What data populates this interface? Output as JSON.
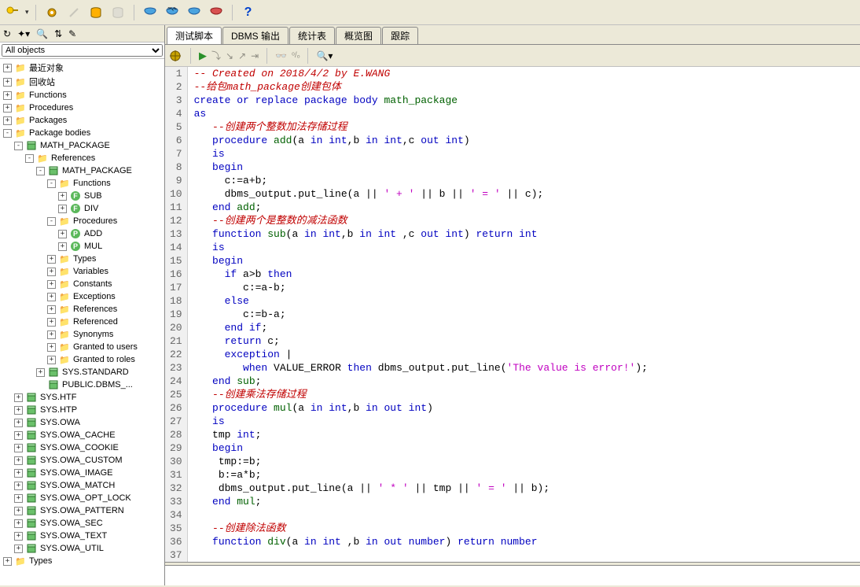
{
  "topToolbar": {
    "help": "?"
  },
  "leftPanel": {
    "filterLabel": "All objects",
    "tree": [
      {
        "indent": 0,
        "toggle": "+",
        "icon": "folder",
        "label": "最近对象"
      },
      {
        "indent": 0,
        "toggle": "+",
        "icon": "folder",
        "label": "回收站"
      },
      {
        "indent": 0,
        "toggle": "+",
        "icon": "folder",
        "label": "Functions"
      },
      {
        "indent": 0,
        "toggle": "+",
        "icon": "folder",
        "label": "Procedures"
      },
      {
        "indent": 0,
        "toggle": "+",
        "icon": "folder",
        "label": "Packages"
      },
      {
        "indent": 0,
        "toggle": "-",
        "icon": "folder",
        "label": "Package bodies"
      },
      {
        "indent": 1,
        "toggle": "-",
        "icon": "pkg",
        "label": "MATH_PACKAGE"
      },
      {
        "indent": 2,
        "toggle": "-",
        "icon": "folder",
        "label": "References"
      },
      {
        "indent": 3,
        "toggle": "-",
        "icon": "pkg",
        "label": "MATH_PACKAGE"
      },
      {
        "indent": 4,
        "toggle": "-",
        "icon": "folder",
        "label": "Functions"
      },
      {
        "indent": 5,
        "toggle": "+",
        "icon": "fn",
        "label": "SUB"
      },
      {
        "indent": 5,
        "toggle": "+",
        "icon": "fn",
        "label": "DIV"
      },
      {
        "indent": 4,
        "toggle": "-",
        "icon": "folder",
        "label": "Procedures"
      },
      {
        "indent": 5,
        "toggle": "+",
        "icon": "proc",
        "label": "ADD"
      },
      {
        "indent": 5,
        "toggle": "+",
        "icon": "proc",
        "label": "MUL"
      },
      {
        "indent": 4,
        "toggle": "+",
        "icon": "folder",
        "label": "Types"
      },
      {
        "indent": 4,
        "toggle": "+",
        "icon": "folder",
        "label": "Variables"
      },
      {
        "indent": 4,
        "toggle": "+",
        "icon": "folder",
        "label": "Constants"
      },
      {
        "indent": 4,
        "toggle": "+",
        "icon": "folder",
        "label": "Exceptions"
      },
      {
        "indent": 4,
        "toggle": "+",
        "icon": "folder",
        "label": "References"
      },
      {
        "indent": 4,
        "toggle": "+",
        "icon": "folder",
        "label": "Referenced"
      },
      {
        "indent": 4,
        "toggle": "+",
        "icon": "folder",
        "label": "Synonyms"
      },
      {
        "indent": 4,
        "toggle": "+",
        "icon": "folder",
        "label": "Granted to users"
      },
      {
        "indent": 4,
        "toggle": "+",
        "icon": "folder",
        "label": "Granted to roles"
      },
      {
        "indent": 3,
        "toggle": "+",
        "icon": "pkg",
        "label": "SYS.STANDARD"
      },
      {
        "indent": 3,
        "toggle": "",
        "icon": "pkg",
        "label": "PUBLIC.DBMS_..."
      },
      {
        "indent": 1,
        "toggle": "+",
        "icon": "pkg",
        "label": "SYS.HTF"
      },
      {
        "indent": 1,
        "toggle": "+",
        "icon": "pkg",
        "label": "SYS.HTP"
      },
      {
        "indent": 1,
        "toggle": "+",
        "icon": "pkg",
        "label": "SYS.OWA"
      },
      {
        "indent": 1,
        "toggle": "+",
        "icon": "pkg",
        "label": "SYS.OWA_CACHE"
      },
      {
        "indent": 1,
        "toggle": "+",
        "icon": "pkg",
        "label": "SYS.OWA_COOKIE"
      },
      {
        "indent": 1,
        "toggle": "+",
        "icon": "pkg",
        "label": "SYS.OWA_CUSTOM"
      },
      {
        "indent": 1,
        "toggle": "+",
        "icon": "pkg",
        "label": "SYS.OWA_IMAGE"
      },
      {
        "indent": 1,
        "toggle": "+",
        "icon": "pkg",
        "label": "SYS.OWA_MATCH"
      },
      {
        "indent": 1,
        "toggle": "+",
        "icon": "pkg",
        "label": "SYS.OWA_OPT_LOCK"
      },
      {
        "indent": 1,
        "toggle": "+",
        "icon": "pkg",
        "label": "SYS.OWA_PATTERN"
      },
      {
        "indent": 1,
        "toggle": "+",
        "icon": "pkg",
        "label": "SYS.OWA_SEC"
      },
      {
        "indent": 1,
        "toggle": "+",
        "icon": "pkg",
        "label": "SYS.OWA_TEXT"
      },
      {
        "indent": 1,
        "toggle": "+",
        "icon": "pkg",
        "label": "SYS.OWA_UTIL"
      },
      {
        "indent": 0,
        "toggle": "+",
        "icon": "folder",
        "label": "Types"
      }
    ]
  },
  "tabs": [
    {
      "label": "测试脚本",
      "active": true
    },
    {
      "label": "DBMS 输出",
      "active": false
    },
    {
      "label": "统计表",
      "active": false
    },
    {
      "label": "概览图",
      "active": false
    },
    {
      "label": "跟踪",
      "active": false
    }
  ],
  "code": {
    "lines": [
      {
        "n": 1,
        "seg": [
          {
            "cls": "c-comment",
            "t": "-- Created on 2018/4/2 by E.WANG "
          }
        ]
      },
      {
        "n": 2,
        "seg": [
          {
            "cls": "c-comment",
            "t": "--给包math_package创建包体"
          }
        ]
      },
      {
        "n": 3,
        "seg": [
          {
            "cls": "c-kw",
            "t": "create or replace package body "
          },
          {
            "cls": "c-pkg",
            "t": "math_package"
          }
        ]
      },
      {
        "n": 4,
        "seg": [
          {
            "cls": "c-kw",
            "t": "as"
          }
        ]
      },
      {
        "n": 5,
        "seg": [
          {
            "cls": "",
            "t": "   "
          },
          {
            "cls": "c-comment",
            "t": "--创建两个整数加法存储过程"
          }
        ]
      },
      {
        "n": 6,
        "seg": [
          {
            "cls": "",
            "t": "   "
          },
          {
            "cls": "c-kw",
            "t": "procedure "
          },
          {
            "cls": "c-pkg",
            "t": "add"
          },
          {
            "cls": "",
            "t": "(a "
          },
          {
            "cls": "c-kw",
            "t": "in int"
          },
          {
            "cls": "",
            "t": ",b "
          },
          {
            "cls": "c-kw",
            "t": "in int"
          },
          {
            "cls": "",
            "t": ",c "
          },
          {
            "cls": "c-kw",
            "t": "out int"
          },
          {
            "cls": "",
            "t": ")"
          }
        ]
      },
      {
        "n": 7,
        "seg": [
          {
            "cls": "",
            "t": "   "
          },
          {
            "cls": "c-kw",
            "t": "is"
          }
        ]
      },
      {
        "n": 8,
        "seg": [
          {
            "cls": "",
            "t": "   "
          },
          {
            "cls": "c-kw",
            "t": "begin"
          }
        ]
      },
      {
        "n": 9,
        "seg": [
          {
            "cls": "",
            "t": "     c:=a+b;"
          }
        ]
      },
      {
        "n": 10,
        "seg": [
          {
            "cls": "",
            "t": "     dbms_output.put_line(a || "
          },
          {
            "cls": "c-str",
            "t": "' + '"
          },
          {
            "cls": "",
            "t": " || b || "
          },
          {
            "cls": "c-str",
            "t": "' = '"
          },
          {
            "cls": "",
            "t": " || c);"
          }
        ]
      },
      {
        "n": 11,
        "seg": [
          {
            "cls": "",
            "t": "   "
          },
          {
            "cls": "c-kw",
            "t": "end "
          },
          {
            "cls": "c-pkg",
            "t": "add"
          },
          {
            "cls": "",
            "t": ";"
          }
        ]
      },
      {
        "n": 12,
        "seg": [
          {
            "cls": "",
            "t": "   "
          },
          {
            "cls": "c-comment",
            "t": "--创建两个是整数的减法函数"
          }
        ]
      },
      {
        "n": 13,
        "seg": [
          {
            "cls": "",
            "t": "   "
          },
          {
            "cls": "c-kw",
            "t": "function "
          },
          {
            "cls": "c-pkg",
            "t": "sub"
          },
          {
            "cls": "",
            "t": "(a "
          },
          {
            "cls": "c-kw",
            "t": "in int"
          },
          {
            "cls": "",
            "t": ",b "
          },
          {
            "cls": "c-kw",
            "t": "in int "
          },
          {
            "cls": "",
            "t": ",c "
          },
          {
            "cls": "c-kw",
            "t": "out int"
          },
          {
            "cls": "",
            "t": ") "
          },
          {
            "cls": "c-kw",
            "t": "return int"
          }
        ]
      },
      {
        "n": 14,
        "seg": [
          {
            "cls": "",
            "t": "   "
          },
          {
            "cls": "c-kw",
            "t": "is"
          }
        ]
      },
      {
        "n": 15,
        "seg": [
          {
            "cls": "",
            "t": "   "
          },
          {
            "cls": "c-kw",
            "t": "begin"
          }
        ]
      },
      {
        "n": 16,
        "seg": [
          {
            "cls": "",
            "t": "     "
          },
          {
            "cls": "c-kw",
            "t": "if"
          },
          {
            "cls": "",
            "t": " a>b "
          },
          {
            "cls": "c-kw",
            "t": "then"
          }
        ]
      },
      {
        "n": 17,
        "seg": [
          {
            "cls": "",
            "t": "        c:=a-b;"
          }
        ]
      },
      {
        "n": 18,
        "seg": [
          {
            "cls": "",
            "t": "     "
          },
          {
            "cls": "c-kw",
            "t": "else"
          }
        ]
      },
      {
        "n": 19,
        "seg": [
          {
            "cls": "",
            "t": "        c:=b-a;"
          }
        ]
      },
      {
        "n": 20,
        "seg": [
          {
            "cls": "",
            "t": "     "
          },
          {
            "cls": "c-kw",
            "t": "end if"
          },
          {
            "cls": "",
            "t": ";"
          }
        ]
      },
      {
        "n": 21,
        "seg": [
          {
            "cls": "",
            "t": "     "
          },
          {
            "cls": "c-kw",
            "t": "return"
          },
          {
            "cls": "",
            "t": " c;"
          }
        ]
      },
      {
        "n": 22,
        "seg": [
          {
            "cls": "",
            "t": "     "
          },
          {
            "cls": "c-kw",
            "t": "exception"
          },
          {
            "cls": "",
            "t": " |"
          }
        ]
      },
      {
        "n": 23,
        "seg": [
          {
            "cls": "",
            "t": "        "
          },
          {
            "cls": "c-kw",
            "t": "when"
          },
          {
            "cls": "",
            "t": " VALUE_ERROR "
          },
          {
            "cls": "c-kw",
            "t": "then"
          },
          {
            "cls": "",
            "t": " dbms_output.put_line("
          },
          {
            "cls": "c-str",
            "t": "'The value is error!'"
          },
          {
            "cls": "",
            "t": ");"
          }
        ]
      },
      {
        "n": 24,
        "seg": [
          {
            "cls": "",
            "t": "   "
          },
          {
            "cls": "c-kw",
            "t": "end "
          },
          {
            "cls": "c-pkg",
            "t": "sub"
          },
          {
            "cls": "",
            "t": ";"
          }
        ]
      },
      {
        "n": 25,
        "seg": [
          {
            "cls": "",
            "t": "   "
          },
          {
            "cls": "c-comment",
            "t": "--创建乘法存储过程"
          }
        ]
      },
      {
        "n": 26,
        "seg": [
          {
            "cls": "",
            "t": "   "
          },
          {
            "cls": "c-kw",
            "t": "procedure "
          },
          {
            "cls": "c-pkg",
            "t": "mul"
          },
          {
            "cls": "",
            "t": "(a "
          },
          {
            "cls": "c-kw",
            "t": "in int"
          },
          {
            "cls": "",
            "t": ",b "
          },
          {
            "cls": "c-kw",
            "t": "in out int"
          },
          {
            "cls": "",
            "t": ")"
          }
        ]
      },
      {
        "n": 27,
        "seg": [
          {
            "cls": "",
            "t": "   "
          },
          {
            "cls": "c-kw",
            "t": "is"
          }
        ]
      },
      {
        "n": 28,
        "seg": [
          {
            "cls": "",
            "t": "   tmp "
          },
          {
            "cls": "c-kw",
            "t": "int"
          },
          {
            "cls": "",
            "t": ";"
          }
        ]
      },
      {
        "n": 29,
        "seg": [
          {
            "cls": "",
            "t": "   "
          },
          {
            "cls": "c-kw",
            "t": "begin"
          }
        ]
      },
      {
        "n": 30,
        "seg": [
          {
            "cls": "",
            "t": "    tmp:=b;"
          }
        ]
      },
      {
        "n": 31,
        "seg": [
          {
            "cls": "",
            "t": "    b:=a*b;"
          }
        ]
      },
      {
        "n": 32,
        "seg": [
          {
            "cls": "",
            "t": "    dbms_output.put_line(a || "
          },
          {
            "cls": "c-str",
            "t": "' * '"
          },
          {
            "cls": "",
            "t": " || tmp || "
          },
          {
            "cls": "c-str",
            "t": "' = '"
          },
          {
            "cls": "",
            "t": " || b);"
          }
        ]
      },
      {
        "n": 33,
        "seg": [
          {
            "cls": "",
            "t": "   "
          },
          {
            "cls": "c-kw",
            "t": "end "
          },
          {
            "cls": "c-pkg",
            "t": "mul"
          },
          {
            "cls": "",
            "t": ";"
          }
        ]
      },
      {
        "n": 34,
        "seg": [
          {
            "cls": "",
            "t": "   "
          }
        ]
      },
      {
        "n": 35,
        "seg": [
          {
            "cls": "",
            "t": "   "
          },
          {
            "cls": "c-comment",
            "t": "--创建除法函数"
          }
        ]
      },
      {
        "n": 36,
        "seg": [
          {
            "cls": "",
            "t": "   "
          },
          {
            "cls": "c-kw",
            "t": "function "
          },
          {
            "cls": "c-pkg",
            "t": "div"
          },
          {
            "cls": "",
            "t": "(a "
          },
          {
            "cls": "c-kw",
            "t": "in int "
          },
          {
            "cls": "",
            "t": ",b "
          },
          {
            "cls": "c-kw",
            "t": "in out number"
          },
          {
            "cls": "",
            "t": ") "
          },
          {
            "cls": "c-kw",
            "t": "return number"
          }
        ]
      },
      {
        "n": 37,
        "seg": [
          {
            "cls": "",
            "t": ""
          }
        ]
      }
    ]
  }
}
